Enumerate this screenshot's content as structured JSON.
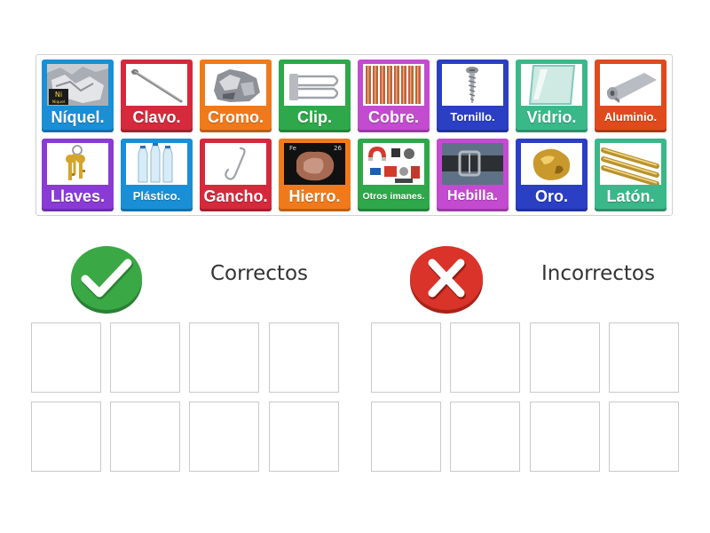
{
  "tiles": [
    {
      "label": "Níquel.",
      "color": "#1a8fd6",
      "icon": "nickel-foil-icon",
      "row": 0,
      "col": 0
    },
    {
      "label": "Clavo.",
      "color": "#d42a3c",
      "icon": "nail-icon",
      "row": 0,
      "col": 1
    },
    {
      "label": "Cromo.",
      "color": "#f07a1b",
      "icon": "chromium-chunk-icon",
      "row": 0,
      "col": 2
    },
    {
      "label": "Clip.",
      "color": "#2ea84a",
      "icon": "safety-pin-icon",
      "row": 0,
      "col": 3
    },
    {
      "label": "Cobre.",
      "color": "#c34bd0",
      "icon": "copper-pipes-icon",
      "row": 0,
      "col": 4
    },
    {
      "label": "Tornillo.",
      "color": "#2a3fc4",
      "icon": "screw-icon",
      "row": 0,
      "col": 5
    },
    {
      "label": "Vidrio.",
      "color": "#3ab88a",
      "icon": "glass-pane-icon",
      "row": 0,
      "col": 6
    },
    {
      "label": "Aluminio.",
      "color": "#e04a1c",
      "icon": "aluminum-roll-icon",
      "row": 0,
      "col": 7
    },
    {
      "label": "Llaves.",
      "color": "#8a3bd6",
      "icon": "keys-icon",
      "row": 1,
      "col": 0
    },
    {
      "label": "Plástico.",
      "color": "#1a8fd6",
      "icon": "plastic-bottles-icon",
      "row": 1,
      "col": 1
    },
    {
      "label": "Gancho.",
      "color": "#d42a3c",
      "icon": "hook-icon",
      "row": 1,
      "col": 2
    },
    {
      "label": "Hierro.",
      "color": "#f07a1b",
      "icon": "iron-element-icon",
      "row": 1,
      "col": 3
    },
    {
      "label": "Otros imanes.",
      "color": "#2ea84a",
      "icon": "magnets-icon",
      "row": 1,
      "col": 4
    },
    {
      "label": "Hebilla.",
      "color": "#c34bd0",
      "icon": "belt-buckle-icon",
      "row": 1,
      "col": 5
    },
    {
      "label": "Oro.",
      "color": "#2a3fc4",
      "icon": "gold-nugget-icon",
      "row": 1,
      "col": 6
    },
    {
      "label": "Latón.",
      "color": "#3ab88a",
      "icon": "brass-tubes-icon",
      "row": 1,
      "col": 7
    }
  ],
  "nickel_badge": {
    "symbol": "Ni",
    "name": "Niquel"
  },
  "iron_badge": {
    "symbol": "Fe",
    "number": "26"
  },
  "groups": {
    "correct": {
      "title": "Correctos",
      "icon": "checkmark-icon",
      "color": "#3aa845"
    },
    "incorrect": {
      "title": "Incorrectos",
      "icon": "cross-icon",
      "color": "#d9332a"
    }
  }
}
